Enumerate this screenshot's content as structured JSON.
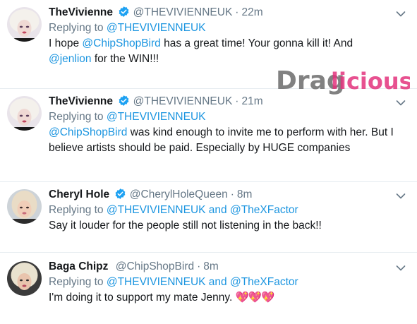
{
  "watermark": {
    "text_a": "Drag",
    "text_b": "licious"
  },
  "tweets": [
    {
      "name": "TheVivienne",
      "handle": "@THEVIVIENNEUK",
      "dot": "·",
      "time": "22m",
      "replying_prefix": "Replying to",
      "replying_to": "@THEVIVIENNEUK",
      "replying_and": "",
      "replying_to_2": "",
      "text_parts": [
        "I hope ",
        "@ChipShopBird",
        " has a great time! Your gonna kill it! And ",
        "@jenlion",
        " for the WIN!!!"
      ]
    },
    {
      "name": "TheVivienne",
      "handle": "@THEVIVIENNEUK",
      "dot": "·",
      "time": "21m",
      "replying_prefix": "Replying to",
      "replying_to": "@THEVIVIENNEUK",
      "replying_and": "",
      "replying_to_2": "",
      "text_parts": [
        "@ChipShopBird",
        " was kind enough to invite me to perform with her. But I believe artists should be paid. Especially by HUGE companies"
      ]
    },
    {
      "name": "Cheryl Hole",
      "handle": "@CherylHoleQueen",
      "dot": "·",
      "time": "8m",
      "replying_prefix": "Replying to",
      "replying_to": "@THEVIVIENNEUK",
      "replying_and": "and",
      "replying_to_2": "@TheXFactor",
      "text_parts": [
        "Say it louder for the people still not listening in the back!!"
      ]
    },
    {
      "name": "Baga Chipz",
      "handle": "@ChipShopBird",
      "dot": "·",
      "time": "8m",
      "replying_prefix": "Replying to",
      "replying_to": "@THEVIVIENNEUK",
      "replying_and": "and",
      "replying_to_2": "@TheXFactor",
      "text_parts": [
        "I'm doing it to support my mate Jenny. ",
        "💖💖💖"
      ]
    }
  ],
  "colors": {
    "link": "#1b95e0",
    "muted": "#657786",
    "verified": "#1da1f2",
    "watermark_gray": "#6b6b6b",
    "watermark_pink": "#e3337c"
  },
  "icons": {
    "verified": "verified-badge-icon",
    "menu": "chevron-down-icon"
  }
}
